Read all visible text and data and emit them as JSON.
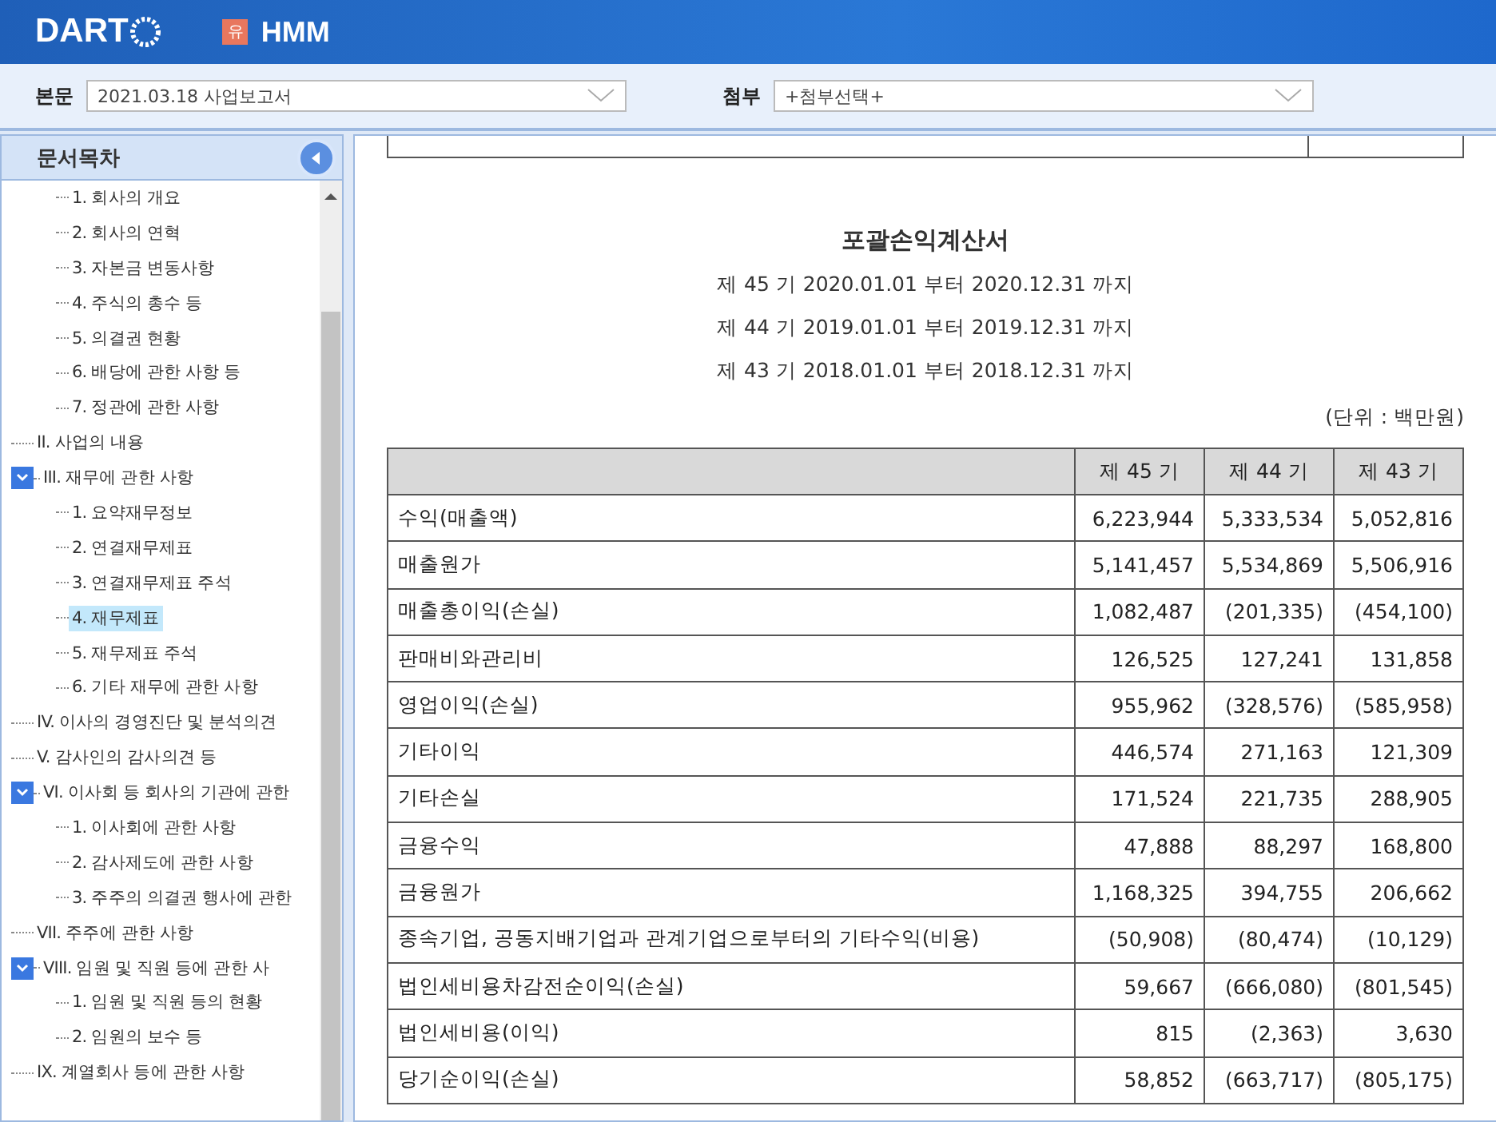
{
  "header": {
    "logo": "DART",
    "company_badge": "유",
    "company": "HMM"
  },
  "toolbar": {
    "main_label": "본문",
    "main_value": "2021.03.18  사업보고서",
    "attach_label": "첨부",
    "attach_value": "+첨부선택+"
  },
  "sidebar": {
    "title": "문서목차",
    "tree": [
      {
        "children": [
          {
            "label": "1. 회사의 개요",
            "selected": false
          },
          {
            "label": "2. 회사의 연혁",
            "selected": false
          },
          {
            "label": "3. 자본금 변동사항",
            "selected": false
          },
          {
            "label": "4. 주식의 총수 등",
            "selected": false
          },
          {
            "label": "5. 의결권 현황",
            "selected": false
          },
          {
            "label": "6. 배당에 관한 사항 등",
            "selected": false
          },
          {
            "label": "7. 정관에 관한 사항",
            "selected": false
          }
        ]
      },
      {
        "label": "II. 사업의 내용",
        "selected": false
      },
      {
        "label": "III. 재무에 관한 사항",
        "selected": false,
        "expanded": true,
        "children": [
          {
            "label": "1. 요약재무정보",
            "selected": false
          },
          {
            "label": "2. 연결재무제표",
            "selected": false
          },
          {
            "label": "3. 연결재무제표 주석",
            "selected": false
          },
          {
            "label": "4. 재무제표",
            "selected": true
          },
          {
            "label": "5. 재무제표 주석",
            "selected": false
          },
          {
            "label": "6. 기타 재무에 관한 사항",
            "selected": false
          }
        ]
      },
      {
        "label": "IV. 이사의 경영진단 및 분석의견",
        "selected": false
      },
      {
        "label": "V. 감사인의 감사의견 등",
        "selected": false
      },
      {
        "label": "VI. 이사회 등 회사의 기관에 관한",
        "selected": false,
        "expanded": true,
        "children": [
          {
            "label": "1. 이사회에 관한 사항",
            "selected": false
          },
          {
            "label": "2. 감사제도에 관한 사항",
            "selected": false
          },
          {
            "label": "3. 주주의 의결권 행사에 관한",
            "selected": false
          }
        ]
      },
      {
        "label": "VII. 주주에 관한 사항",
        "selected": false
      },
      {
        "label": "VIII. 임원 및 직원 등에 관한 사",
        "selected": false,
        "expanded": true,
        "children": [
          {
            "label": "1. 임원 및 직원 등의 현황",
            "selected": false
          },
          {
            "label": "2. 임원의 보수 등",
            "selected": false
          }
        ]
      },
      {
        "label": "IX. 계열회사 등에 관한 사항",
        "selected": false
      }
    ]
  },
  "document": {
    "title": "포괄손익계산서",
    "periods": [
      "제 45 기 2020.01.01 부터 2020.12.31 까지",
      "제 44 기 2019.01.01 부터 2019.12.31 까지",
      "제 43 기 2018.01.01 부터 2018.12.31 까지"
    ],
    "unit": "(단위 : 백만원)",
    "table": {
      "columns": [
        "",
        "제 45 기",
        "제 44 기",
        "제 43 기"
      ],
      "rows": [
        [
          "수익(매출액)",
          "6,223,944",
          "5,333,534",
          "5,052,816"
        ],
        [
          "매출원가",
          "5,141,457",
          "5,534,869",
          "5,506,916"
        ],
        [
          "매출총이익(손실)",
          "1,082,487",
          "(201,335)",
          "(454,100)"
        ],
        [
          "판매비와관리비",
          "126,525",
          "127,241",
          "131,858"
        ],
        [
          "영업이익(손실)",
          "955,962",
          "(328,576)",
          "(585,958)"
        ],
        [
          "기타이익",
          "446,574",
          "271,163",
          "121,309"
        ],
        [
          "기타손실",
          "171,524",
          "221,735",
          "288,905"
        ],
        [
          "금융수익",
          "47,888",
          "88,297",
          "168,800"
        ],
        [
          "금융원가",
          "1,168,325",
          "394,755",
          "206,662"
        ],
        [
          "종속기업, 공동지배기업과 관계기업으로부터의 기타수익(비용)",
          "(50,908)",
          "(80,474)",
          "(10,129)"
        ],
        [
          "법인세비용차감전순이익(손실)",
          "59,667",
          "(666,080)",
          "(801,545)"
        ],
        [
          "법인세비용(이익)",
          "815",
          "(2,363)",
          "3,630"
        ],
        [
          "당기순이익(손실)",
          "58,852",
          "(663,717)",
          "(805,175)"
        ]
      ]
    }
  }
}
